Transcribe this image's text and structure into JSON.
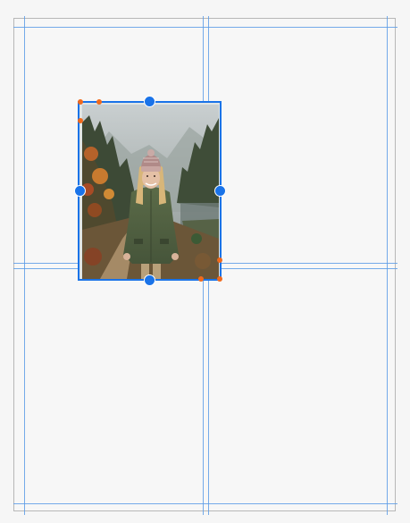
{
  "document": {
    "type": "page layout editor"
  },
  "selection": {
    "element": "image",
    "image_subject": "photo-woman-hiking-misty-forest"
  },
  "colors": {
    "guide": "#5d9ce6",
    "selection": "#1a73e8",
    "crop_handle": "#f06a1d",
    "page_border": "#b7b7b7",
    "background": "#f6f6f6"
  }
}
